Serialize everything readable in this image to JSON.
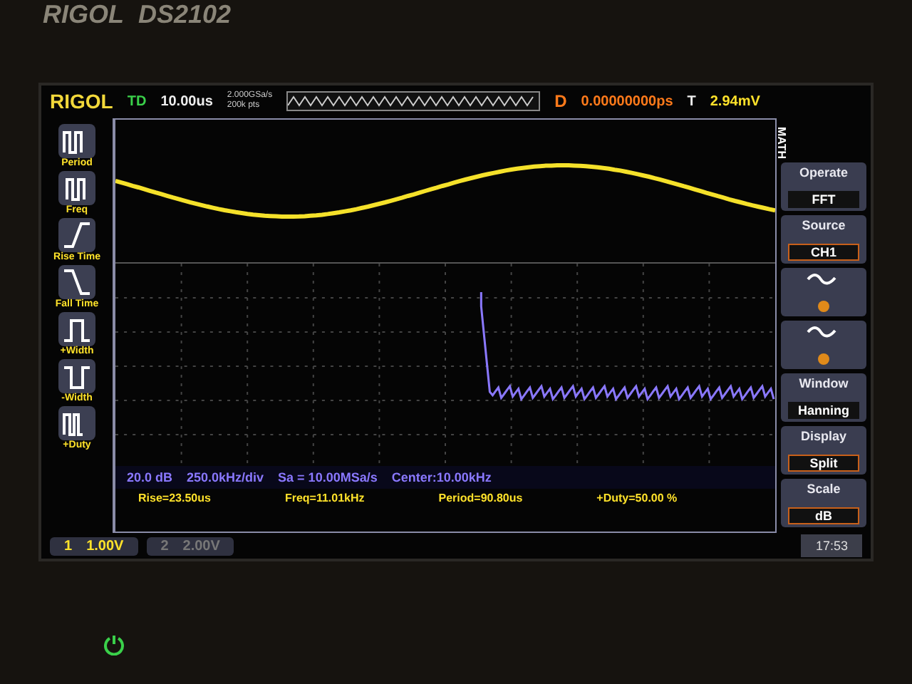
{
  "bezel": {
    "brand": "RIGOL",
    "model": "DS2102"
  },
  "header": {
    "brand": "RIGOL",
    "mode": "TD",
    "timebase": "10.00us",
    "sample_rate": "2.000GSa/s",
    "memory_depth": "200k pts",
    "delay_label": "D",
    "delay": "0.00000000ps",
    "trigger_label": "T",
    "trigger_level": "2.94mV"
  },
  "measure_menu": [
    {
      "label": "Period"
    },
    {
      "label": "Freq"
    },
    {
      "label": "Rise Time"
    },
    {
      "label": "Fall Time"
    },
    {
      "label": "+Width"
    },
    {
      "label": "-Width"
    },
    {
      "label": "+Duty"
    }
  ],
  "math_menu": {
    "title": "MATH",
    "items": [
      {
        "kind": "cycle",
        "label": "Operate",
        "value": "FFT"
      },
      {
        "kind": "select",
        "label": "Source",
        "value": "CH1"
      },
      {
        "kind": "knob"
      },
      {
        "kind": "knob"
      },
      {
        "kind": "cycle",
        "label": "Window",
        "value": "Hanning"
      },
      {
        "kind": "select",
        "label": "Display",
        "value": "Split"
      },
      {
        "kind": "select",
        "label": "Scale",
        "value": "dB"
      }
    ]
  },
  "fft_info": [
    "20.0 dB",
    "250.0kHz/div",
    "Sa = 10.00MSa/s",
    "Center:10.00kHz"
  ],
  "measurements": [
    "Rise=23.50us",
    "Freq=11.01kHz",
    "Period=90.80us",
    "+Duty=50.00 %"
  ],
  "channels": [
    {
      "number": "1",
      "value": "1.00V",
      "enabled": true
    },
    {
      "number": "2",
      "value": "2.00V",
      "enabled": false
    }
  ],
  "clock": "17:53"
}
